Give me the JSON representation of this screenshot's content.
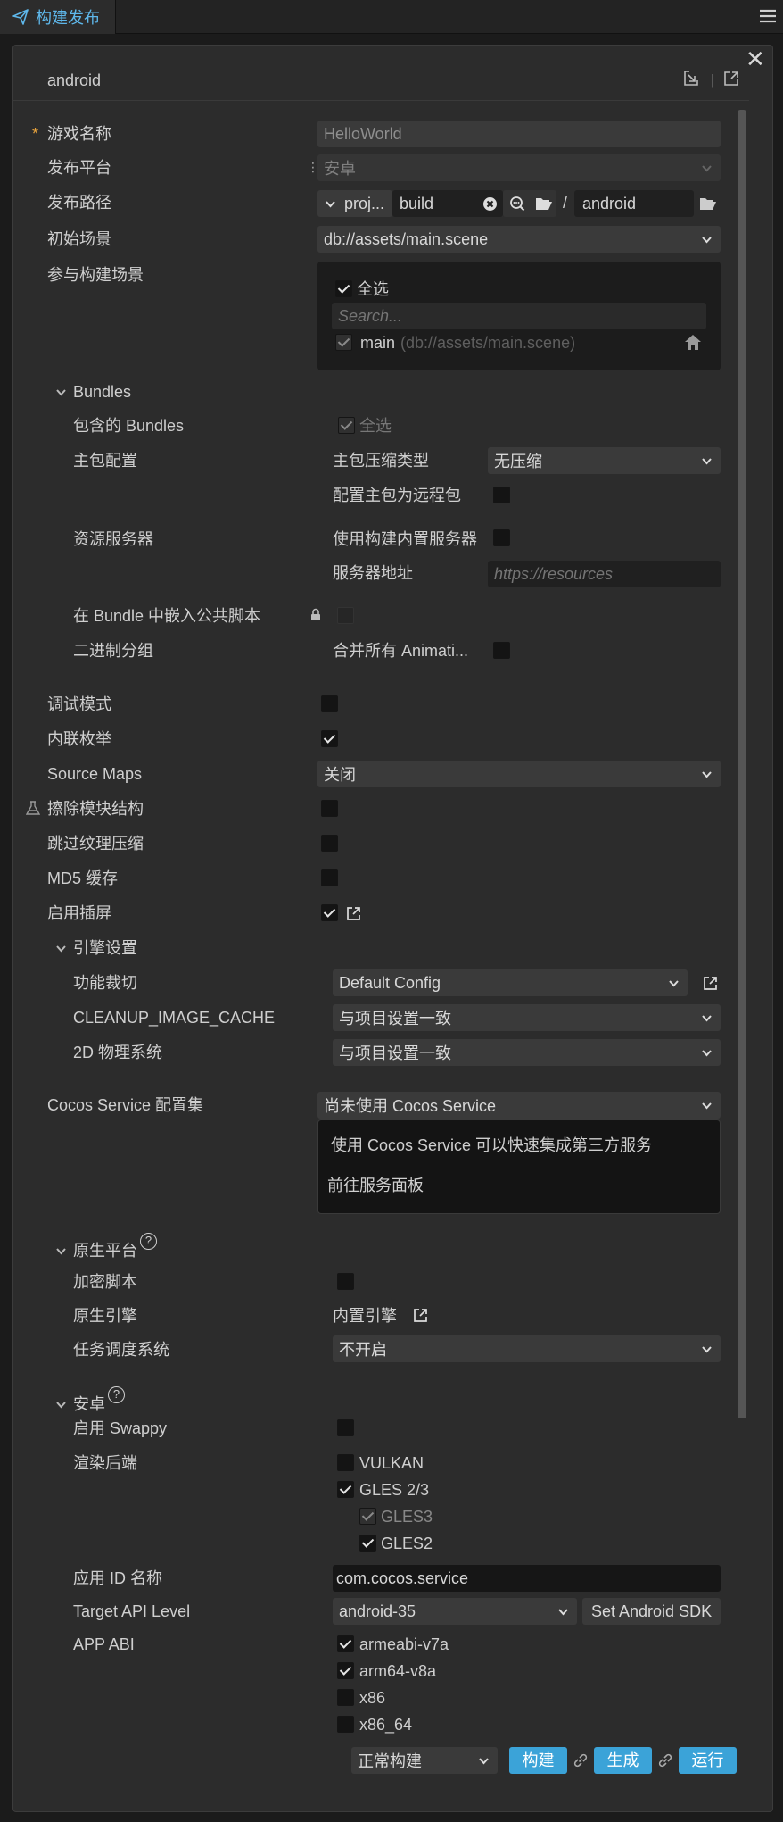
{
  "tab": {
    "title": "构建发布"
  },
  "header": {
    "platform": "android"
  },
  "general": {
    "game_name_label": "游戏名称",
    "game_name_value": "HelloWorld",
    "platform_label": "发布平台",
    "platform_value": "安卓",
    "path_label": "发布路径",
    "path_prefix": "proj...",
    "path_build": "build",
    "path_sep": "/",
    "path_target": "android",
    "start_scene_label": "初始场景",
    "start_scene_value": "db://assets/main.scene",
    "scenes_label": "参与构建场景",
    "select_all": "全选",
    "search_placeholder": "Search...",
    "scene_name": "main",
    "scene_path": "(db://assets/main.scene)"
  },
  "bundles": {
    "header": "Bundles",
    "included_label": "包含的 Bundles",
    "included_value": "全选",
    "main_config_label": "主包配置",
    "compress_label": "主包压缩类型",
    "compress_value": "无压缩",
    "remote_label": "配置主包为远程包",
    "server_label": "资源服务器",
    "builtin_server_label": "使用构建内置服务器",
    "server_addr_label": "服务器地址",
    "server_addr_placeholder": "https://resources",
    "embed_label": "在 Bundle 中嵌入公共脚本",
    "binary_label": "二进制分组",
    "merge_label": "合并所有 Animati..."
  },
  "options": {
    "debug_label": "调试模式",
    "inline_enum_label": "内联枚举",
    "source_maps_label": "Source Maps",
    "source_maps_value": "关闭",
    "mangle_label": "擦除模块结构",
    "skip_tex_label": "跳过纹理压缩",
    "md5_label": "MD5 缓存",
    "splash_label": "启用插屏"
  },
  "engine": {
    "header": "引擎设置",
    "cull_label": "功能裁切",
    "cull_value": "Default Config",
    "cleanup_label": "CLEANUP_IMAGE_CACHE",
    "cleanup_value": "与项目设置一致",
    "physics_label": "2D 物理系统",
    "physics_value": "与项目设置一致"
  },
  "service": {
    "label": "Cocos Service 配置集",
    "value": "尚未使用 Cocos Service",
    "desc": "使用 Cocos Service 可以快速集成第三方服务",
    "link": "前往服务面板"
  },
  "native": {
    "header": "原生平台",
    "hint": "?",
    "encrypt_label": "加密脚本",
    "engine_label": "原生引擎",
    "engine_value": "内置引擎",
    "jobsys_label": "任务调度系统",
    "jobsys_value": "不开启"
  },
  "android": {
    "header": "安卓",
    "hint": "?",
    "swappy_label": "启用 Swappy",
    "render_label": "渲染后端",
    "vulkan": "VULKAN",
    "gles23": "GLES 2/3",
    "gles3": "GLES3",
    "gles2": "GLES2",
    "appid_label": "应用 ID 名称",
    "appid_value": "com.cocos.service",
    "api_label": "Target API Level",
    "api_value": "android-35",
    "sdk_button": "Set Android SDK",
    "abi_label": "APP ABI",
    "abi1": "armeabi-v7a",
    "abi2": "arm64-v8a",
    "abi3": "x86",
    "abi4": "x86_64"
  },
  "footer": {
    "mode_value": "正常构建",
    "build_button": "构建",
    "make_button": "生成",
    "run_button": "运行"
  },
  "colors": {
    "accent": "#3ba3d8",
    "tab_text": "#5eb7ea",
    "required": "#e8a33d",
    "panel": "#2c2c2c",
    "field": "#3a3a3a"
  }
}
